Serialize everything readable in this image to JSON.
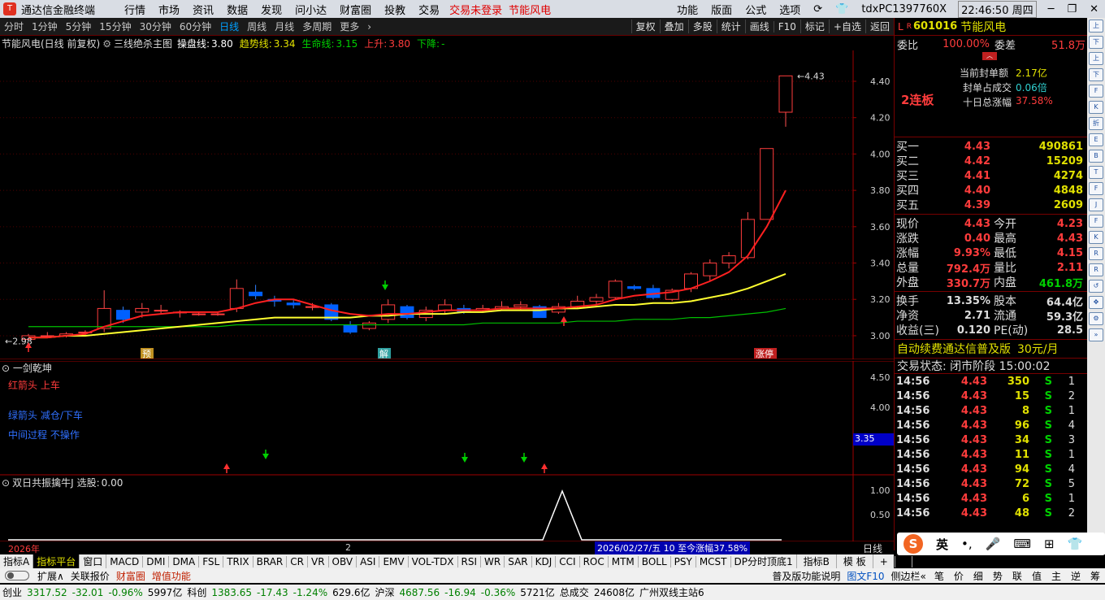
{
  "menubar": {
    "app_title": "通达信金融终端",
    "items": [
      "行情",
      "市场",
      "资讯",
      "数据",
      "发现",
      "问小达",
      "财富圈",
      "投教",
      "交易"
    ],
    "login_warn": "交易未登录",
    "stock_name": "节能风电",
    "right_items": [
      "功能",
      "版面",
      "公式",
      "选项"
    ],
    "pc_name": "tdxPC1397760X",
    "clock": "22:46:50 周四"
  },
  "periods": {
    "items": [
      "分时",
      "1分钟",
      "5分钟",
      "15分钟",
      "30分钟",
      "60分钟",
      "日线",
      "周线",
      "月线",
      "多周期",
      "更多"
    ],
    "active": "日线",
    "tools": [
      "复权",
      "叠加",
      "多股",
      "统计",
      "画线",
      "F10",
      "标记",
      "+自选",
      "返回"
    ]
  },
  "info": {
    "name": "节能风电(日线 前复权)",
    "indicator": "三线绝杀主图",
    "l1": "操盘线:",
    "v1": "3.80",
    "l2": "趋势线:",
    "v2": "3.34",
    "l3": "生命线:",
    "v3": "3.15",
    "l4": "上升:",
    "v4": "3.80",
    "l5": "下降:",
    "v5": "-"
  },
  "chart_data": {
    "type": "candlestick",
    "yticks": [
      "4.40",
      "4.20",
      "4.00",
      "3.80",
      "3.60",
      "3.40",
      "3.20",
      "3.00"
    ],
    "ylim": [
      2.87,
      4.57
    ],
    "high_label": "4.43",
    "low_label": "2.98",
    "markers": [
      {
        "text": "预"
      },
      {
        "text": "解"
      },
      {
        "text": "涨停"
      }
    ],
    "candles": [
      [
        2.98,
        3.0,
        2.98,
        3.01
      ],
      [
        3.0,
        3.0,
        2.99,
        3.02
      ],
      [
        3.0,
        3.01,
        2.99,
        3.02
      ],
      [
        3.02,
        3.02,
        3.0,
        3.03
      ],
      [
        3.04,
        3.15,
        3.02,
        3.25
      ],
      [
        3.14,
        3.09,
        3.07,
        3.16
      ],
      [
        3.13,
        3.15,
        3.1,
        3.18
      ],
      [
        3.14,
        3.14,
        3.12,
        3.17
      ],
      [
        3.13,
        3.13,
        3.1,
        3.14
      ],
      [
        3.12,
        3.12,
        3.11,
        3.13
      ],
      [
        3.12,
        3.12,
        3.11,
        3.13
      ],
      [
        3.15,
        3.26,
        3.13,
        3.31
      ],
      [
        3.24,
        3.22,
        3.2,
        3.28
      ],
      [
        3.2,
        3.19,
        3.16,
        3.22
      ],
      [
        3.18,
        3.17,
        3.15,
        3.2
      ],
      [
        3.16,
        3.16,
        3.14,
        3.18
      ],
      [
        3.17,
        3.09,
        3.08,
        3.18
      ],
      [
        3.06,
        3.02,
        3.01,
        3.08
      ],
      [
        3.04,
        3.07,
        3.03,
        3.08
      ],
      [
        3.09,
        3.17,
        3.07,
        3.2
      ],
      [
        3.16,
        3.1,
        3.09,
        3.17
      ],
      [
        3.1,
        3.14,
        3.08,
        3.16
      ],
      [
        3.14,
        3.17,
        3.12,
        3.2
      ],
      [
        3.15,
        3.13,
        3.12,
        3.17
      ],
      [
        3.14,
        3.15,
        3.13,
        3.17
      ],
      [
        3.15,
        3.16,
        3.14,
        3.19
      ],
      [
        3.16,
        3.17,
        3.14,
        3.19
      ],
      [
        3.16,
        3.1,
        3.1,
        3.17
      ],
      [
        3.13,
        3.16,
        3.12,
        3.18
      ],
      [
        3.16,
        3.19,
        3.15,
        3.22
      ],
      [
        3.19,
        3.21,
        3.17,
        3.23
      ],
      [
        3.21,
        3.3,
        3.2,
        3.31
      ],
      [
        3.27,
        3.26,
        3.25,
        3.28
      ],
      [
        3.26,
        3.21,
        3.2,
        3.28
      ],
      [
        3.2,
        3.25,
        3.19,
        3.26
      ],
      [
        3.26,
        3.34,
        3.24,
        3.35
      ],
      [
        3.33,
        3.4,
        3.3,
        3.42
      ],
      [
        3.4,
        3.44,
        3.37,
        3.46
      ],
      [
        3.43,
        3.64,
        3.42,
        3.68
      ],
      [
        3.64,
        4.03,
        3.64,
        4.03
      ],
      [
        4.23,
        4.43,
        4.15,
        4.43
      ]
    ],
    "ma_red": [
      2.99,
      2.99,
      3.0,
      3.01,
      3.05,
      3.08,
      3.11,
      3.12,
      3.13,
      3.13,
      3.13,
      3.15,
      3.18,
      3.2,
      3.2,
      3.17,
      3.14,
      3.12,
      3.11,
      3.12,
      3.12,
      3.13,
      3.14,
      3.14,
      3.14,
      3.15,
      3.15,
      3.15,
      3.15,
      3.16,
      3.17,
      3.2,
      3.22,
      3.23,
      3.24,
      3.26,
      3.3,
      3.35,
      3.44,
      3.6,
      3.8
    ],
    "ma_yellow": [
      2.99,
      2.99,
      3.0,
      3.0,
      3.01,
      3.02,
      3.03,
      3.04,
      3.05,
      3.06,
      3.07,
      3.08,
      3.09,
      3.1,
      3.1,
      3.1,
      3.1,
      3.1,
      3.11,
      3.11,
      3.12,
      3.12,
      3.12,
      3.13,
      3.13,
      3.14,
      3.14,
      3.14,
      3.15,
      3.15,
      3.16,
      3.17,
      3.17,
      3.18,
      3.18,
      3.19,
      3.21,
      3.23,
      3.26,
      3.3,
      3.34
    ],
    "ma_green": [
      3.05,
      3.05,
      3.05,
      3.05,
      3.05,
      3.05,
      3.05,
      3.05,
      3.05,
      3.05,
      3.05,
      3.06,
      3.06,
      3.06,
      3.06,
      3.06,
      3.06,
      3.06,
      3.06,
      3.06,
      3.06,
      3.06,
      3.06,
      3.06,
      3.07,
      3.07,
      3.07,
      3.07,
      3.07,
      3.08,
      3.08,
      3.08,
      3.09,
      3.09,
      3.09,
      3.1,
      3.1,
      3.11,
      3.12,
      3.13,
      3.15
    ]
  },
  "sub1": {
    "title": "一剑乾坤",
    "legend": [
      "红箭头 上车",
      "绿箭头 减仓/下车",
      "中间过程 不操作"
    ],
    "yticks": [
      "4.50",
      "4.00"
    ],
    "current": "3.35"
  },
  "sub2": {
    "title": "双日共振擒牛J",
    "label": "选股:",
    "value": "0.00",
    "yticks": [
      "1.00",
      "0.50"
    ],
    "year": "2026年",
    "month": "2",
    "tooltip": "2026/02/27/五 10 至今涨幅37.58%",
    "xlabel": "日线"
  },
  "quote": {
    "market": "L",
    "code": "601016",
    "name": "节能风电",
    "wb_label": "委比",
    "wb": "100.00%",
    "wc_label": "委差",
    "wc": "51.8万",
    "lianban": "2连板",
    "seal_amt_label": "当前封单额",
    "seal_amt": "2.17亿",
    "seal_ratio_label": "封单占成交",
    "seal_ratio": "0.06倍",
    "ten_day_label": "十日总涨幅",
    "ten_day": "37.58%",
    "bids": [
      {
        "l": "买一",
        "p": "4.43",
        "v": "490861"
      },
      {
        "l": "买二",
        "p": "4.42",
        "v": "15209"
      },
      {
        "l": "买三",
        "p": "4.41",
        "v": "4274"
      },
      {
        "l": "买四",
        "p": "4.40",
        "v": "4848"
      },
      {
        "l": "买五",
        "p": "4.39",
        "v": "2609"
      }
    ],
    "stats": [
      {
        "l1": "现价",
        "v1": "4.43",
        "l2": "今开",
        "v2": "4.23"
      },
      {
        "l1": "涨跌",
        "v1": "0.40",
        "l2": "最高",
        "v2": "4.43"
      },
      {
        "l1": "涨幅",
        "v1": "9.93%",
        "l2": "最低",
        "v2": "4.15"
      },
      {
        "l1": "总量",
        "v1": "792.4万",
        "l2": "量比",
        "v2": "2.11"
      },
      {
        "l1": "外盘",
        "v1": "330.7万",
        "l2": "内盘",
        "v2": "461.8万"
      }
    ],
    "stats2": [
      {
        "l1": "换手",
        "v1": "13.35%",
        "l2": "股本",
        "v2": "64.4亿"
      },
      {
        "l1": "净资",
        "v1": "2.71",
        "l2": "流通",
        "v2": "59.3亿"
      },
      {
        "l1": "收益(三)",
        "v1": "0.120",
        "l2": "PE(动)",
        "v2": "28.5"
      }
    ],
    "ad": "自动续费通达信普及版",
    "ad_price": "30元/月",
    "status": "交易状态: 闭市阶段 15:00:02",
    "ticks": [
      [
        "14:56",
        "4.43",
        "350",
        "S",
        "1"
      ],
      [
        "14:56",
        "4.43",
        "15",
        "S",
        "2"
      ],
      [
        "14:56",
        "4.43",
        "8",
        "S",
        "1"
      ],
      [
        "14:56",
        "4.43",
        "96",
        "S",
        "4"
      ],
      [
        "14:56",
        "4.43",
        "34",
        "S",
        "3"
      ],
      [
        "14:56",
        "4.43",
        "11",
        "S",
        "1"
      ],
      [
        "14:56",
        "4.43",
        "94",
        "S",
        "4"
      ],
      [
        "14:56",
        "4.43",
        "72",
        "S",
        "5"
      ],
      [
        "14:56",
        "4.43",
        "6",
        "S",
        "1"
      ],
      [
        "14:56",
        "4.43",
        "48",
        "S",
        "2"
      ]
    ]
  },
  "tabs": [
    "指标A",
    "指标平台",
    "窗口",
    "MACD",
    "DMI",
    "DMA",
    "FSL",
    "TRIX",
    "BRAR",
    "CR",
    "VR",
    "OBV",
    "ASI",
    "EMV",
    "VOL-TDX",
    "RSI",
    "WR",
    "SAR",
    "KDJ",
    "CCI",
    "ROC",
    "MTM",
    "BOLL",
    "PSY",
    "MCST",
    "DP分时顶底1"
  ],
  "tabs_right": [
    "指标B",
    "模 板",
    "+",
    "-"
  ],
  "bottom2": {
    "items": [
      "扩展∧",
      "关联报价",
      "财富圈",
      "增值功能"
    ],
    "right": [
      "普及版功能说明",
      "图文F10",
      "侧边栏«",
      "笔",
      "价",
      "细",
      "势",
      "联",
      "值",
      "主",
      "逆",
      "筹"
    ]
  },
  "statusbar": {
    "items": [
      "创业",
      "3317.52",
      "-32.01",
      "-0.96%",
      "5997亿",
      "科创",
      "1383.65",
      "-17.43",
      "-1.24%",
      "629.6亿",
      "沪深",
      "4687.56",
      "-16.94",
      "-0.36%",
      "5721亿",
      "总成交",
      "24608亿",
      "广州双线主站6"
    ]
  },
  "ime": {
    "items": [
      "英",
      "•,",
      "🎤",
      "⌨",
      "⊞",
      "👕"
    ]
  },
  "sidebar_icons": [
    "上",
    "下",
    "上",
    "下",
    "F",
    "K",
    "折",
    "E",
    "B",
    "T",
    "F",
    "J",
    "F",
    "K",
    "R",
    "R",
    "↺",
    "✥",
    "⚙",
    "»"
  ]
}
